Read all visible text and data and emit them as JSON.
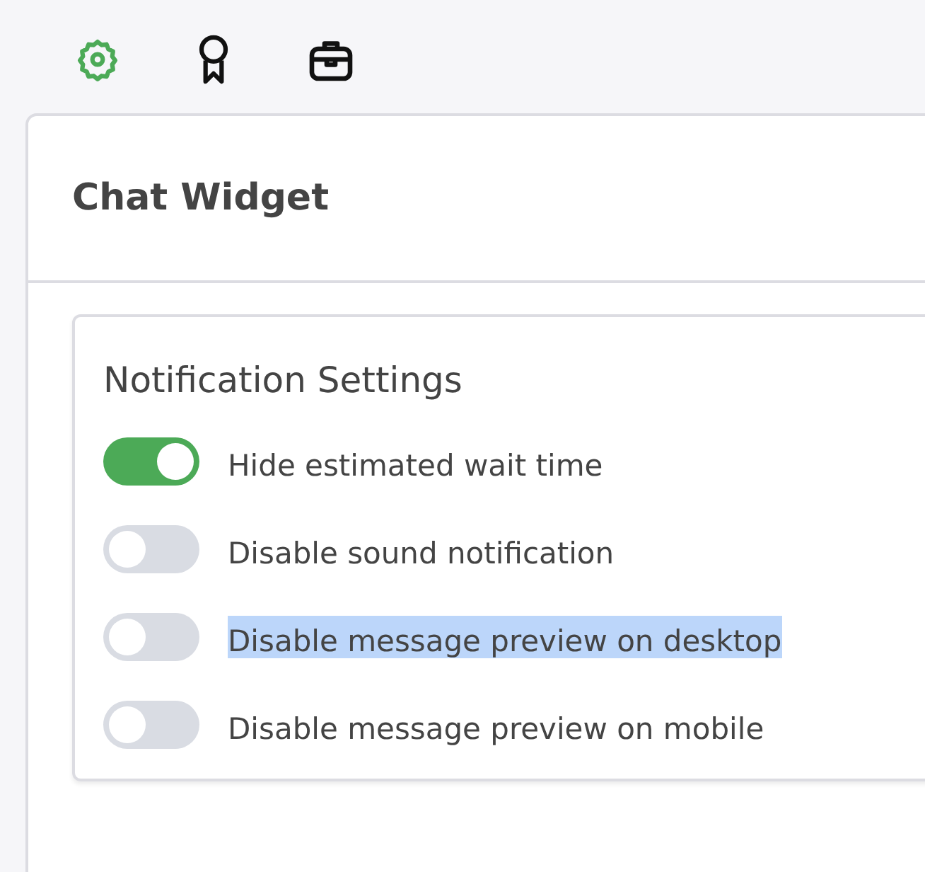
{
  "toolbar": [
    {
      "kind": "gear",
      "selected": true
    },
    {
      "kind": "award",
      "selected": false
    },
    {
      "kind": "briefcase",
      "selected": false
    }
  ],
  "panel": {
    "title": "Chat Widget"
  },
  "card": {
    "title": "Notification Settings",
    "toggles": [
      {
        "label": "Hide estimated wait time",
        "on": true,
        "text_selected": false
      },
      {
        "label": "Disable sound notification",
        "on": false,
        "text_selected": false
      },
      {
        "label": "Disable message preview on desktop",
        "on": false,
        "text_selected": true
      },
      {
        "label": "Disable message preview on mobile",
        "on": false,
        "text_selected": false
      }
    ]
  }
}
